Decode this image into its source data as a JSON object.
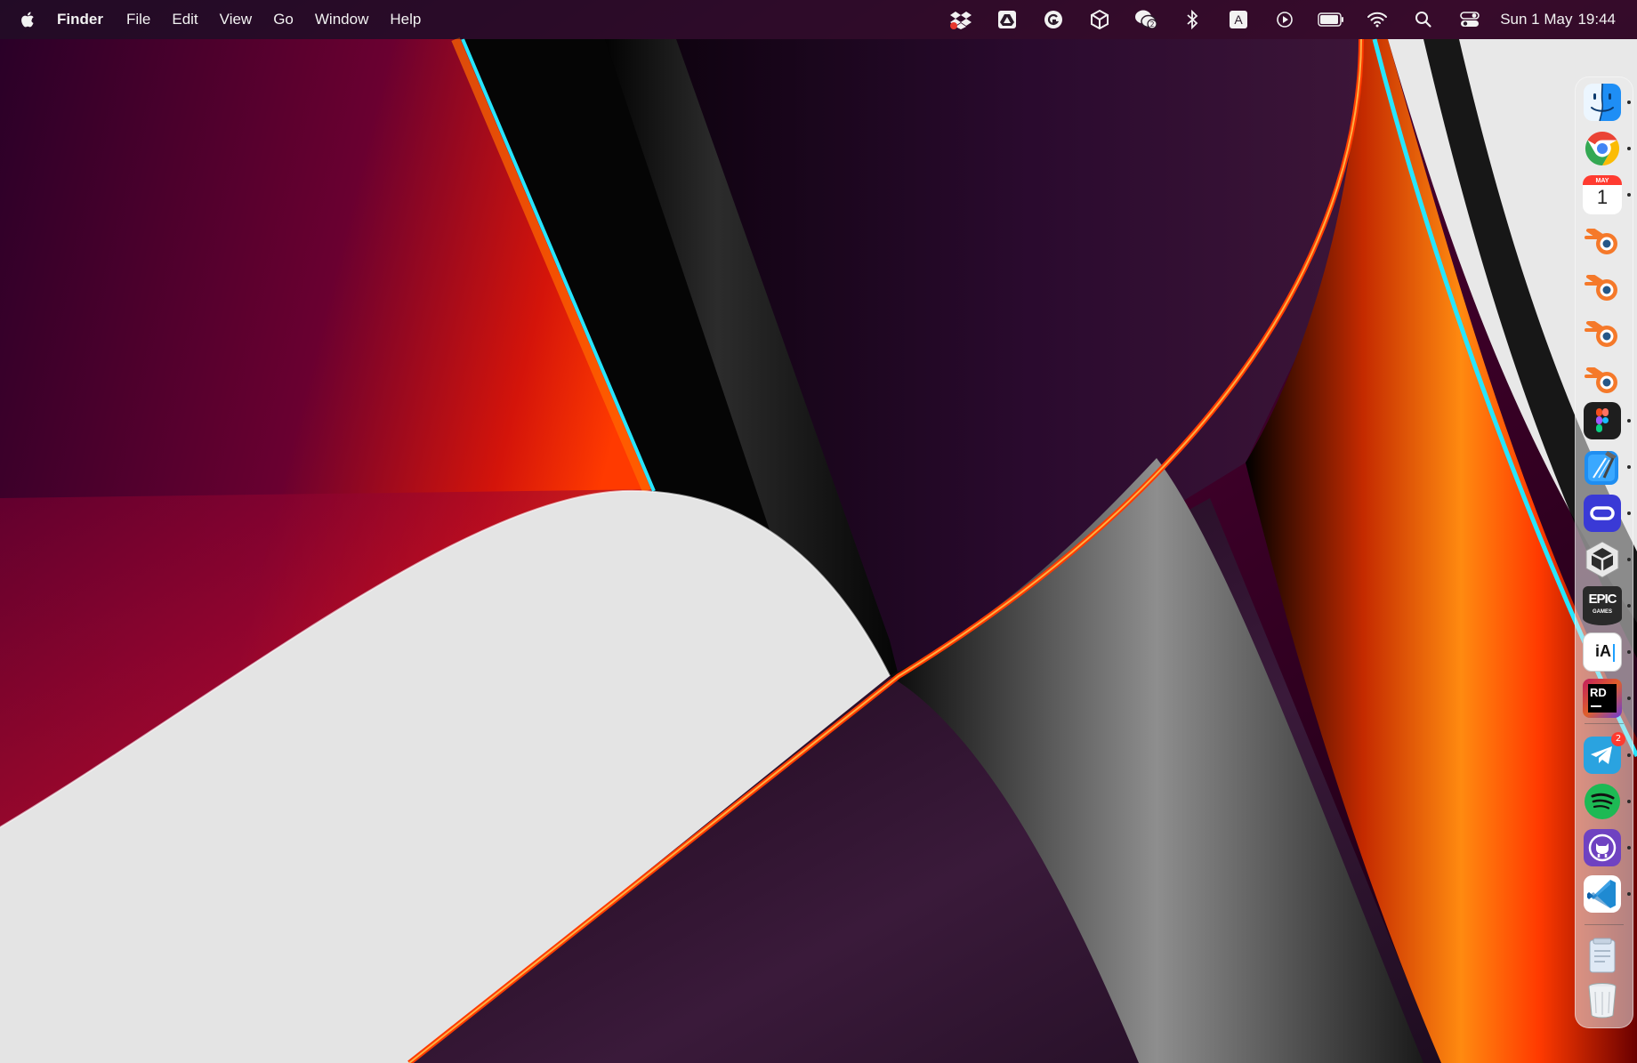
{
  "menubar": {
    "apple_icon": "apple-logo-icon",
    "app_name": "Finder",
    "menus": [
      "File",
      "Edit",
      "View",
      "Go",
      "Window",
      "Help"
    ],
    "status_icons": [
      "dropbox-icon",
      "google-drive-icon",
      "grammarly-icon",
      "unity-hub-icon",
      "wechat-icon",
      "bluetooth-icon",
      "input-source-icon",
      "now-playing-icon",
      "battery-icon",
      "wifi-icon",
      "spotlight-search-icon",
      "control-center-icon"
    ],
    "wechat_badge": "2",
    "input_source_label": "A",
    "clock": {
      "date": "Sun 1 May",
      "time": "19:44"
    }
  },
  "dock": {
    "apps": [
      {
        "name": "Finder",
        "icon": "finder-icon",
        "running": true
      },
      {
        "name": "Google Chrome",
        "icon": "chrome-icon",
        "running": true
      },
      {
        "name": "Calendar",
        "icon": "calendar-icon",
        "running": true,
        "month": "MAY",
        "day": "1"
      },
      {
        "name": "Blender",
        "icon": "blender-icon",
        "running": false
      },
      {
        "name": "Blender",
        "icon": "blender-icon",
        "running": false
      },
      {
        "name": "Blender",
        "icon": "blender-icon",
        "running": false
      },
      {
        "name": "Blender",
        "icon": "blender-icon",
        "running": false
      },
      {
        "name": "Figma",
        "icon": "figma-icon",
        "running": true
      },
      {
        "name": "Xcode",
        "icon": "xcode-icon",
        "running": true
      },
      {
        "name": "Oculus",
        "icon": "oculus-icon",
        "running": true
      },
      {
        "name": "Unity Hub",
        "icon": "unity-hub-icon",
        "running": true
      },
      {
        "name": "Epic Games Launcher",
        "icon": "epic-games-icon",
        "running": true,
        "label_top": "EPIC",
        "label_bottom": "GAMES"
      },
      {
        "name": "iA Writer",
        "icon": "ia-writer-icon",
        "running": true,
        "label": "iA"
      },
      {
        "name": "JetBrains Rider",
        "icon": "rider-icon",
        "running": true,
        "label": "RD"
      }
    ],
    "recent_apps": [
      {
        "name": "Telegram",
        "icon": "telegram-icon",
        "running": true,
        "badge": "2"
      },
      {
        "name": "Spotify",
        "icon": "spotify-icon",
        "running": true
      },
      {
        "name": "GitHub Desktop",
        "icon": "github-desktop-icon",
        "running": true
      },
      {
        "name": "Visual Studio Code",
        "icon": "vscode-icon",
        "running": true
      }
    ],
    "utilities": [
      {
        "name": "Downloads",
        "icon": "downloads-stack-icon"
      },
      {
        "name": "Trash",
        "icon": "trash-icon"
      }
    ]
  },
  "colors": {
    "wallpaper_red": "#ff1a00",
    "wallpaper_orange": "#ff7a00",
    "wallpaper_cyan": "#27e6ff",
    "wallpaper_purple": "#2a0a2e",
    "paper_white": "#e4e4e4"
  }
}
